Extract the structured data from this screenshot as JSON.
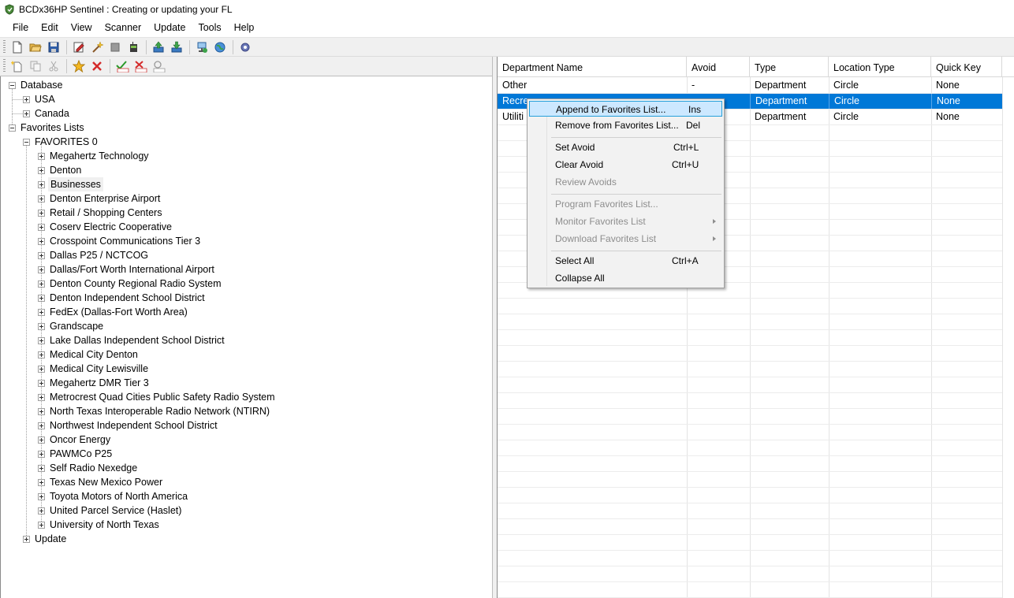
{
  "window": {
    "title": "BCDx36HP Sentinel : Creating or updating your FL"
  },
  "menu": [
    "File",
    "Edit",
    "View",
    "Scanner",
    "Update",
    "Tools",
    "Help"
  ],
  "toolbar_icons": [
    "new-file-icon",
    "open-folder-icon",
    "save-icon",
    "edit-icon",
    "wand-icon",
    "stop-icon",
    "scanner-icon",
    "upload-icon",
    "download-icon",
    "network-icon",
    "globe-icon",
    "settings-icon"
  ],
  "left_toolbar_icons": [
    "new-item-icon",
    "copy-icon",
    "cut-icon",
    "favorite-star-icon",
    "delete-x-icon",
    "set-avoid-icon",
    "clear-avoid-icon",
    "avoid-list-icon"
  ],
  "tree": {
    "database": "Database",
    "usa": "USA",
    "canada": "Canada",
    "favorites_lists": "Favorites Lists",
    "favorites0": "FAVORITES 0",
    "favorites_items": [
      "Megahertz Technology",
      "Denton",
      "Businesses",
      "Denton Enterprise Airport",
      "Retail / Shopping Centers",
      "Coserv Electric Cooperative",
      "Crosspoint Communications Tier 3",
      "Dallas P25 / NCTCOG",
      "Dallas/Fort Worth International Airport",
      "Denton County Regional Radio System",
      "Denton Independent School District",
      "FedEx (Dallas-Fort Worth Area)",
      "Grandscape",
      "Lake Dallas Independent School District",
      "Medical City Denton",
      "Medical City Lewisville",
      "Megahertz DMR Tier 3",
      "Metrocrest Quad Cities Public Safety Radio System",
      "North Texas Interoperable Radio Network (NTIRN)",
      "Northwest Independent School District",
      "Oncor Energy",
      "PAWMCo P25",
      "Self Radio Nexedge",
      "Texas New Mexico Power",
      "Toyota Motors of North America",
      "United Parcel Service (Haslet)",
      "University of North Texas"
    ],
    "update": "Update"
  },
  "grid": {
    "columns": [
      "Department Name",
      "Avoid",
      "Type",
      "Location Type",
      "Quick Key"
    ],
    "rows": [
      [
        "Other",
        "-",
        "Department",
        "Circle",
        "None"
      ],
      [
        "Recre",
        "",
        "Department",
        "Circle",
        "None"
      ],
      [
        "Utiliti",
        "",
        "Department",
        "Circle",
        "None"
      ]
    ]
  },
  "context_menu": {
    "append": "Append to Favorites List...",
    "append_sc": "Ins",
    "remove": "Remove from Favorites List...",
    "remove_sc": "Del",
    "set_avoid": "Set Avoid",
    "set_avoid_sc": "Ctrl+L",
    "clear_avoid": "Clear Avoid",
    "clear_avoid_sc": "Ctrl+U",
    "review_avoids": "Review Avoids",
    "program_fl": "Program Favorites List...",
    "monitor_fl": "Monitor Favorites List",
    "download_fl": "Download Favorites List",
    "select_all": "Select All",
    "select_all_sc": "Ctrl+A",
    "collapse_all": "Collapse All"
  },
  "colors": {
    "selection": "#0078d7",
    "menu_hover": "#cce8ff"
  }
}
